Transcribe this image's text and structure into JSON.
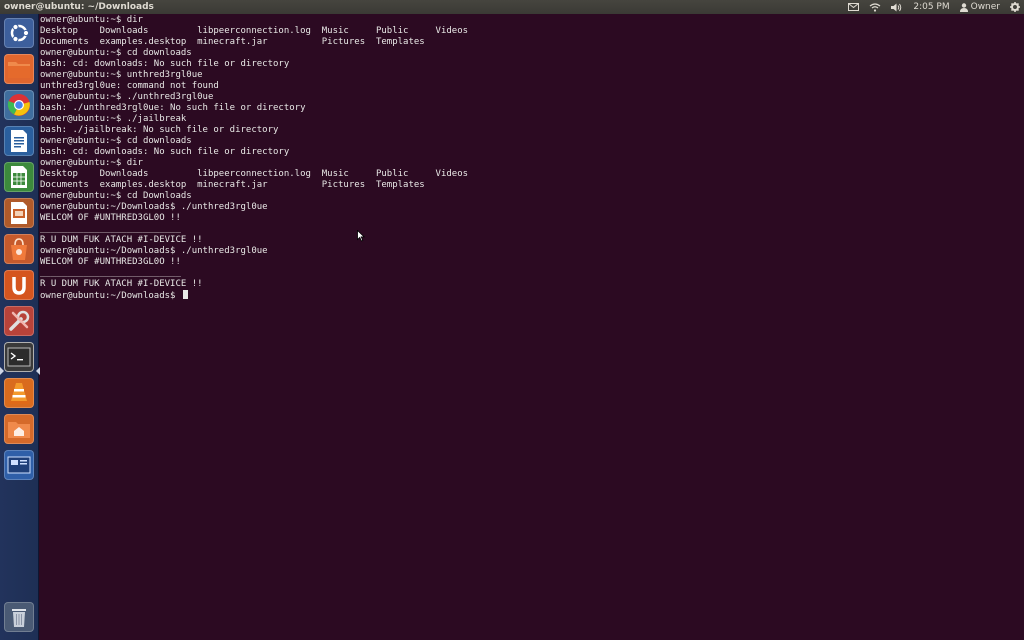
{
  "topbar": {
    "window_title": "owner@ubuntu: ~/Downloads",
    "clock": "2:05 PM",
    "user": "Owner",
    "icons": [
      "mail-icon",
      "wifi-icon",
      "volume-icon",
      "user-icon",
      "gear-icon"
    ]
  },
  "launcher": {
    "items": [
      {
        "name": "dash-home",
        "icon": "ubuntu-logo-icon"
      },
      {
        "name": "files",
        "icon": "folder-icon"
      },
      {
        "name": "chromium",
        "icon": "chrome-icon"
      },
      {
        "name": "libreoffice-writer",
        "icon": "writer-icon"
      },
      {
        "name": "libreoffice-calc",
        "icon": "calc-icon"
      },
      {
        "name": "libreoffice-impress",
        "icon": "impress-icon"
      },
      {
        "name": "software-center",
        "icon": "shopping-bag-icon"
      },
      {
        "name": "ubuntu-one",
        "icon": "ubuntu-one-icon"
      },
      {
        "name": "system-settings",
        "icon": "settings-icon"
      },
      {
        "name": "terminal",
        "icon": "terminal-icon"
      },
      {
        "name": "vlc",
        "icon": "vlc-cone-icon"
      },
      {
        "name": "home-folder",
        "icon": "home-folder-icon"
      },
      {
        "name": "workspace-switcher",
        "icon": "workspace-icon"
      },
      {
        "name": "trash",
        "icon": "trash-icon"
      }
    ]
  },
  "terminal": {
    "lines": [
      "owner@ubuntu:~$ dir",
      "Desktop    Downloads         libpeerconnection.log  Music     Public     Videos",
      "Documents  examples.desktop  minecraft.jar          Pictures  Templates",
      "owner@ubuntu:~$ cd downloads",
      "bash: cd: downloads: No such file or directory",
      "owner@ubuntu:~$ unthred3rgl0ue",
      "unthred3rgl0ue: command not found",
      "owner@ubuntu:~$ ./unthred3rgl0ue",
      "bash: ./unthred3rgl0ue: No such file or directory",
      "owner@ubuntu:~$ ./jailbreak",
      "bash: ./jailbreak: No such file or directory",
      "owner@ubuntu:~$ cd downloads",
      "bash: cd: downloads: No such file or directory",
      "owner@ubuntu:~$ dir",
      "Desktop    Downloads         libpeerconnection.log  Music     Public     Videos",
      "Documents  examples.desktop  minecraft.jar          Pictures  Templates",
      "owner@ubuntu:~$ cd Downloads",
      "owner@ubuntu:~/Downloads$ ./unthred3rgl0ue",
      "WELCOM OF #UNTHRED3GL0O !!",
      "__________________________",
      "R U DUM FUK ATACH #I-DEVICE !!",
      "owner@ubuntu:~/Downloads$ ./unthred3rgl0ue",
      "WELCOM OF #UNTHRED3GL0O !!",
      "__________________________",
      "R U DUM FUK ATACH #I-DEVICE !!",
      "owner@ubuntu:~/Downloads$ "
    ]
  },
  "colors": {
    "terminal_bg": "#2c0a22",
    "terminal_fg": "#e8e8e6",
    "launcher_bg": "#22335c",
    "topbar_bg": "#3b3a35"
  }
}
